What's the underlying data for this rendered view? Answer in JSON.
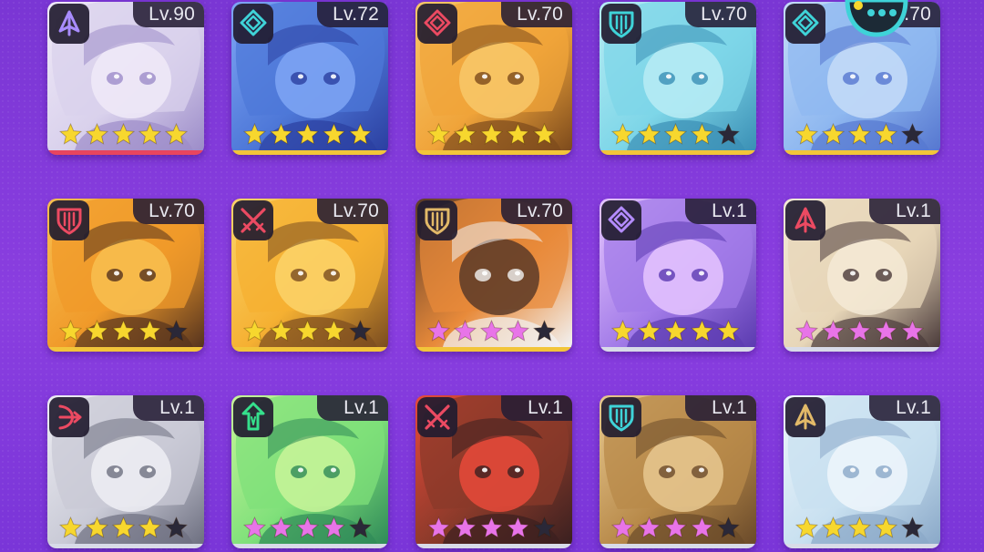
{
  "colors": {
    "rarity_red": "#e8455e",
    "rarity_gold": "#f2c53a",
    "rarity_silver": "#d8dbe8",
    "star_gold": "#f7d72e",
    "star_pink": "#e874e8",
    "star_empty": "#2a2838",
    "icon_cyan": "#3fd3d8",
    "icon_red": "#ec4a62",
    "icon_green": "#35e08c",
    "icon_tan": "#e2b968"
  },
  "roster": [
    {
      "level": "Lv.90",
      "class_icon": "arrow-sigil-icon",
      "icon_color": "#a98cff",
      "stars": 5,
      "star_color": "gold",
      "rarity": "red",
      "palette": [
        "#d9d1ec",
        "#9c8cc9",
        "#f0eaf8"
      ]
    },
    {
      "level": "Lv.72",
      "class_icon": "diamond-sigil-icon",
      "icon_color": "#3fd3d8",
      "stars": 5,
      "star_color": "gold",
      "rarity": "gold",
      "palette": [
        "#4e78d8",
        "#2b3fa0",
        "#7fa6f5"
      ]
    },
    {
      "level": "Lv.70",
      "class_icon": "diamond-sigil-icon",
      "icon_color": "#ec4a62",
      "stars": 5,
      "star_color": "gold",
      "rarity": "gold",
      "palette": [
        "#f0a43a",
        "#7c4a1c",
        "#f8c86a"
      ]
    },
    {
      "level": "Lv.70",
      "class_icon": "shield-sigil-icon",
      "icon_color": "#3fd3d8",
      "stars": 4,
      "star_color": "gold",
      "rarity": "gold",
      "palette": [
        "#7ed6e8",
        "#3a8fb5",
        "#b8ecf4"
      ]
    },
    {
      "level": "Lv.70",
      "class_icon": "diamond-sigil-icon",
      "icon_color": "#3fd3d8",
      "stars": 4,
      "star_color": "gold",
      "rarity": "gold",
      "palette": [
        "#8fb8f0",
        "#5677d0",
        "#c5dcf8"
      ]
    },
    {
      "level": "Lv.70",
      "class_icon": "shield-sigil-icon",
      "icon_color": "#ec4a62",
      "stars": 4,
      "star_color": "gold",
      "rarity": "gold",
      "palette": [
        "#f09a2a",
        "#55331e",
        "#f8c050"
      ]
    },
    {
      "level": "Lv.70",
      "class_icon": "crossed-swords-icon",
      "icon_color": "#ec4a62",
      "stars": 4,
      "star_color": "gold",
      "rarity": "gold",
      "palette": [
        "#f5b032",
        "#7a4c20",
        "#fbd46a"
      ]
    },
    {
      "level": "Lv.70",
      "class_icon": "shield-sigil-icon",
      "icon_color": "#e2b968",
      "stars": 4,
      "star_color": "pink",
      "rarity": "gold",
      "palette": [
        "#e88a3a",
        "#f2f2f2",
        "#5a3a28"
      ]
    },
    {
      "level": "Lv.1",
      "class_icon": "diamond-sigil-icon",
      "icon_color": "#b48cff",
      "stars": 5,
      "star_color": "gold",
      "rarity": "silver",
      "palette": [
        "#a27be8",
        "#5b3bb0",
        "#e6c6ff"
      ]
    },
    {
      "level": "Lv.1",
      "class_icon": "arrow-sigil-icon",
      "icon_color": "#ec4a62",
      "stars": 5,
      "star_color": "pink",
      "rarity": "silver",
      "palette": [
        "#e7d6b8",
        "#4a3a3a",
        "#f4ead6"
      ]
    },
    {
      "level": "Lv.1",
      "class_icon": "bow-sigil-icon",
      "icon_color": "#ec4a62",
      "stars": 4,
      "star_color": "gold",
      "rarity": "silver",
      "palette": [
        "#c9cad6",
        "#6d6f80",
        "#eeeef4"
      ]
    },
    {
      "level": "Lv.1",
      "class_icon": "rune-sigil-icon",
      "icon_color": "#35e08c",
      "stars": 4,
      "star_color": "pink",
      "rarity": "silver",
      "palette": [
        "#7fe07a",
        "#2f8a58",
        "#c9f59a"
      ]
    },
    {
      "level": "Lv.1",
      "class_icon": "crossed-swords-icon",
      "icon_color": "#ec4a62",
      "stars": 4,
      "star_color": "pink",
      "rarity": "silver",
      "palette": [
        "#8a3a2a",
        "#3a2020",
        "#e84a3a"
      ]
    },
    {
      "level": "Lv.1",
      "class_icon": "shield-sigil-icon",
      "icon_color": "#3fd3d8",
      "stars": 4,
      "star_color": "pink",
      "rarity": "silver",
      "palette": [
        "#b88a4a",
        "#6a4a2a",
        "#e8c890"
      ]
    },
    {
      "level": "Lv.1",
      "class_icon": "arrow-sigil-icon",
      "icon_color": "#e2b968",
      "stars": 4,
      "star_color": "gold",
      "rarity": "silver",
      "palette": [
        "#c8e0f0",
        "#8aa8c8",
        "#eef6fb"
      ]
    }
  ],
  "overlay": {
    "icon": "chat-bubble-icon",
    "color": "#3fd3d8"
  }
}
